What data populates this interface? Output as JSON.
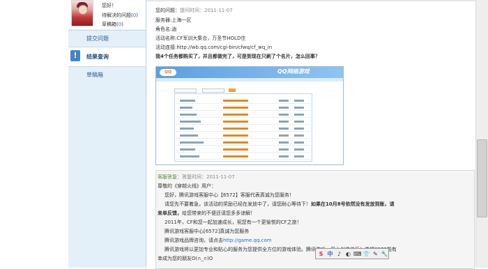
{
  "profile": {
    "line1": "您好！",
    "pending_label": "待解决的问题(",
    "pending_count": "0",
    "pending_close": ")",
    "draft_label": "草稿箱(",
    "draft_count": "0",
    "draft_close": ")"
  },
  "sidebar": {
    "items": [
      {
        "label": "提交问题"
      },
      {
        "label": "结果查询"
      },
      {
        "label": "草稿箱"
      }
    ],
    "active_icon": "!"
  },
  "question": {
    "title_label": "您的问题：",
    "time_label": "提问时间：2011-11-07",
    "server": "服务器:上海一区",
    "role": "角色名:逍",
    "activity": "活动名称:CF军训大集合，万圣节HOLD住",
    "link": "活动连接:http://wb.qq.com/cgi-bin/cfwq/cf_wq_in",
    "body": "我4个任务都购买了，并且都做完了，可是到现在只刷了个名片，怎么回事？"
  },
  "attachment": {
    "logo": "QQ",
    "brand": "QQ网络游戏"
  },
  "answer": {
    "header_label": "客服答复：",
    "time_label": "答复时间：2011-11-07",
    "greeting": "尊敬的《穿越火线》用户：",
    "line1": "您好，腾讯游戏客服中心【6572】客服代表真诚为您服务！",
    "line2_a": "请您先不要着急，该活动的奖励已经在发放中了，请您耐心等待下！",
    "line2_b": "如果在10月8号依然没有发放到账，请",
    "line3": "来单反馈，",
    "line3_b": "给您带来的不便还请您多多谅解！",
    "line4": "2011年，CF和您一起加速成长，祝您有一个更愉悦的CF之旅！",
    "line5": "腾讯游戏客服中心[6572]真诚为您服务",
    "line6_a": "腾讯游戏品牌咨询，请点击",
    "line6_link": "http://game.qq.com",
    "line7": "腾讯游戏将以更加专业和贴心的服务为您提供全方位的游戏体验。腾讯游戏，用心创造快乐！希望6572能有",
    "line8": "幸成为您的朋友O(∩_∩)O"
  },
  "ime": {
    "items": [
      "S",
      "中",
      "♪",
      "◐",
      "⌨",
      "👕",
      "✎",
      "🔧"
    ]
  }
}
